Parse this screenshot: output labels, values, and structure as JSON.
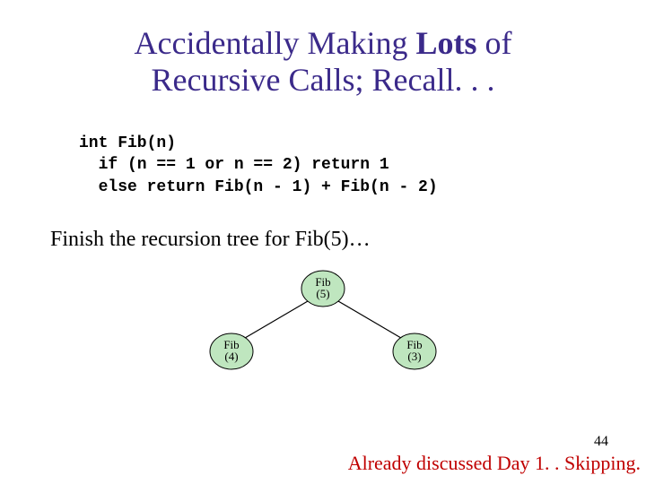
{
  "title": {
    "pre": "Accidentally Making ",
    "bold": "Lots",
    "post": " of",
    "line2": "Recursive Calls; Recall. . ."
  },
  "code": {
    "l1": "int Fib(n)",
    "l2": "  if (n == 1 or n == 2) return 1",
    "l3": "  else return Fib(n - 1) + Fib(n - 2)"
  },
  "prompt": "Finish the recursion tree for Fib(5)…",
  "tree": {
    "root": {
      "l1": "Fib",
      "l2": "(5)"
    },
    "left": {
      "l1": "Fib",
      "l2": "(4)"
    },
    "right": {
      "l1": "Fib",
      "l2": "(3)"
    }
  },
  "footer": {
    "page": "44",
    "note": "Already discussed Day 1. . Skipping."
  },
  "colors": {
    "title": "#3b2a8a",
    "node_fill": "#bfe6bf",
    "note": "#c00000"
  }
}
